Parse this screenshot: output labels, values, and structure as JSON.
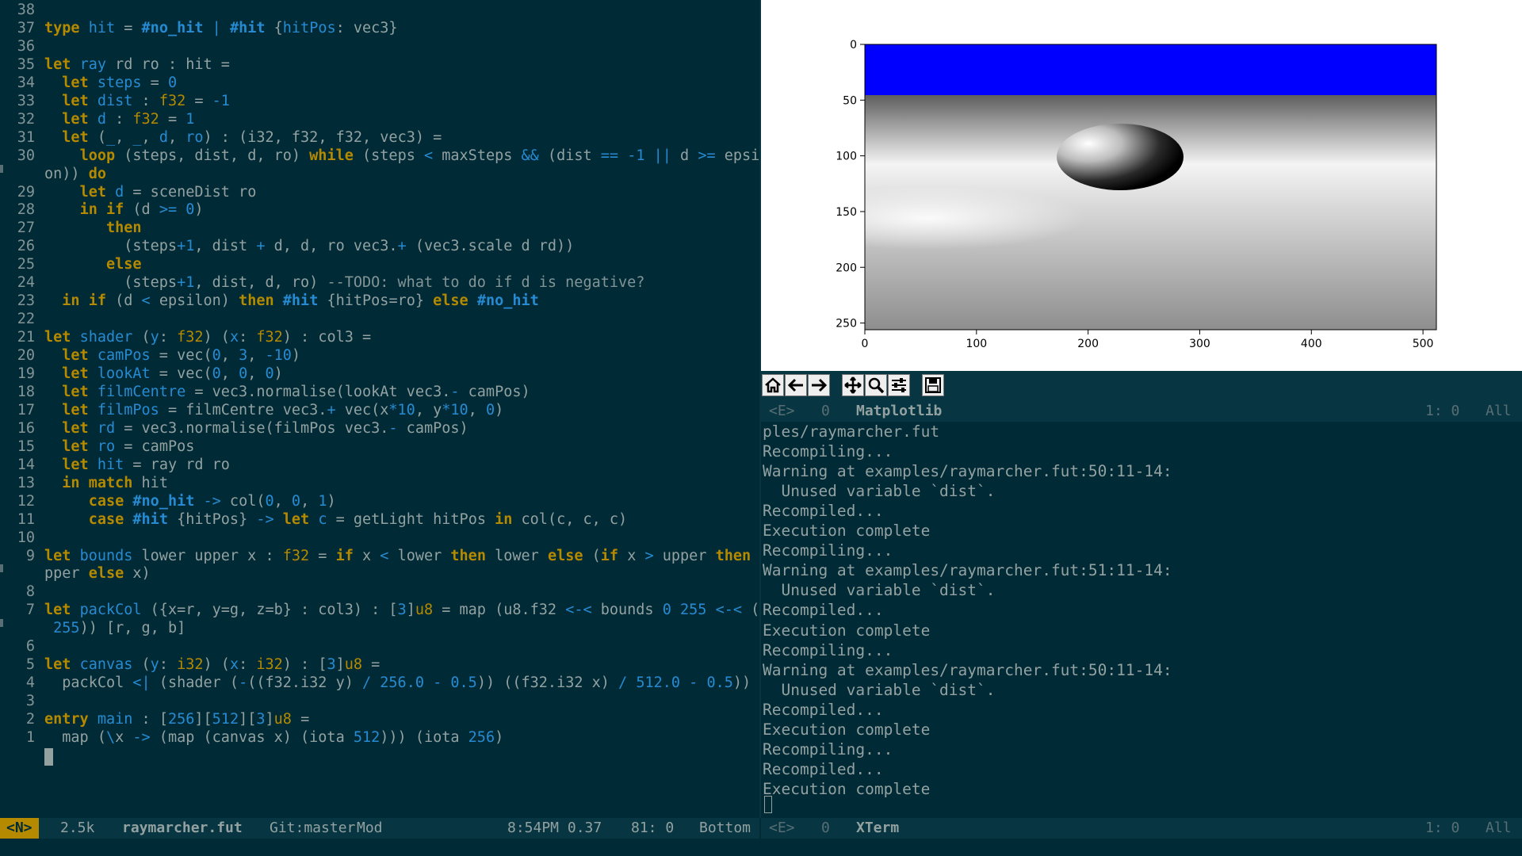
{
  "editor": {
    "lines": [
      {
        "n": "38",
        "c": ""
      },
      {
        "n": "37",
        "c": "<span class=\"k\">type</span> <span class=\"v\">hit</span> = <span class=\"tag\">#no_hit</span> <span class=\"o\">|</span> <span class=\"tag\">#hit</span> {<span class=\"v\">hitPos</span>: vec3}"
      },
      {
        "n": "36",
        "c": ""
      },
      {
        "n": "35",
        "c": "<span class=\"k\">let</span> <span class=\"v\">ray</span> rd ro : hit ="
      },
      {
        "n": "34",
        "c": "  <span class=\"k\">let</span> <span class=\"v\">steps</span> = <span class=\"n\">0</span>"
      },
      {
        "n": "33",
        "c": "  <span class=\"k\">let</span> <span class=\"v\">dist</span> : <span class=\"t\">f32</span> = <span class=\"n\">-1</span>"
      },
      {
        "n": "32",
        "c": "  <span class=\"k\">let</span> <span class=\"v\">d</span> : <span class=\"t\">f32</span> = <span class=\"n\">1</span>"
      },
      {
        "n": "31",
        "c": "  <span class=\"k\">let</span> (<span class=\"v\">_</span>, <span class=\"v\">_</span>, <span class=\"v\">d</span>, <span class=\"v\">ro</span>) : (i32, f32, f32, vec3) ="
      },
      {
        "n": "30",
        "c": "    <span class=\"k\">loop</span> (steps, dist, d, ro) <span class=\"k\">while</span> (steps <span class=\"o\">&lt;</span> maxSteps <span class=\"o\">&amp;&amp;</span> (dist <span class=\"o\">==</span> <span class=\"n\">-1</span> <span class=\"o\">||</span> d <span class=\"o\">&gt;=</span> epsil"
      },
      {
        "n": "",
        "c": "on)) <span class=\"k\">do</span>",
        "cont": true
      },
      {
        "n": "29",
        "c": "    <span class=\"k\">let</span> <span class=\"v\">d</span> = sceneDist ro"
      },
      {
        "n": "28",
        "c": "    <span class=\"k\">in</span> <span class=\"k\">if</span> (d <span class=\"o\">&gt;=</span> <span class=\"n\">0</span>)"
      },
      {
        "n": "27",
        "c": "       <span class=\"k\">then</span>"
      },
      {
        "n": "26",
        "c": "         (steps<span class=\"o\">+</span><span class=\"n\">1</span>, dist <span class=\"o\">+</span> d, d, ro vec3.<span class=\"o\">+</span> (vec3.scale d rd))"
      },
      {
        "n": "25",
        "c": "       <span class=\"k\">else</span>"
      },
      {
        "n": "24",
        "c": "         (steps<span class=\"o\">+</span><span class=\"n\">1</span>, dist, d, ro) <span class=\"c\">--TODO: what to do if d is negative?</span>"
      },
      {
        "n": "23",
        "c": "  <span class=\"k\">in</span> <span class=\"k\">if</span> (d <span class=\"o\">&lt;</span> epsilon) <span class=\"k\">then</span> <span class=\"tag\">#hit</span> {hitPos=ro} <span class=\"k\">else</span> <span class=\"tag\">#no_hit</span>"
      },
      {
        "n": "22",
        "c": ""
      },
      {
        "n": "21",
        "c": "<span class=\"k\">let</span> <span class=\"v\">shader</span> (<span class=\"v\">y</span>: <span class=\"t\">f32</span>) (<span class=\"v\">x</span>: <span class=\"t\">f32</span>) : col3 ="
      },
      {
        "n": "20",
        "c": "  <span class=\"k\">let</span> <span class=\"v\">camPos</span> = vec(<span class=\"n\">0</span>, <span class=\"n\">3</span>, <span class=\"n\">-10</span>)"
      },
      {
        "n": "19",
        "c": "  <span class=\"k\">let</span> <span class=\"v\">lookAt</span> = vec(<span class=\"n\">0</span>, <span class=\"n\">0</span>, <span class=\"n\">0</span>)"
      },
      {
        "n": "18",
        "c": "  <span class=\"k\">let</span> <span class=\"v\">filmCentre</span> = vec3.normalise(lookAt vec3.<span class=\"o\">-</span> camPos)"
      },
      {
        "n": "17",
        "c": "  <span class=\"k\">let</span> <span class=\"v\">filmPos</span> = filmCentre vec3.<span class=\"o\">+</span> vec(x<span class=\"o\">*</span><span class=\"n\">10</span>, y<span class=\"o\">*</span><span class=\"n\">10</span>, <span class=\"n\">0</span>)"
      },
      {
        "n": "16",
        "c": "  <span class=\"k\">let</span> <span class=\"v\">rd</span> = vec3.normalise(filmPos vec3.<span class=\"o\">-</span> camPos)"
      },
      {
        "n": "15",
        "c": "  <span class=\"k\">let</span> <span class=\"v\">ro</span> = camPos"
      },
      {
        "n": "14",
        "c": "  <span class=\"k\">let</span> <span class=\"v\">hit</span> = ray rd ro"
      },
      {
        "n": "13",
        "c": "  <span class=\"k\">in</span> <span class=\"k\">match</span> hit"
      },
      {
        "n": "12",
        "c": "     <span class=\"k\">case</span> <span class=\"tag\">#no_hit</span> <span class=\"o\">-&gt;</span> col(<span class=\"n\">0</span>, <span class=\"n\">0</span>, <span class=\"n\">1</span>)"
      },
      {
        "n": "11",
        "c": "     <span class=\"k\">case</span> <span class=\"tag\">#hit</span> {hitPos} <span class=\"o\">-&gt;</span> <span class=\"k\">let</span> <span class=\"v\">c</span> = getLight hitPos <span class=\"k\">in</span> col(c, c, c)"
      },
      {
        "n": "10",
        "c": ""
      },
      {
        "n": "9",
        "c": "<span class=\"k\">let</span> <span class=\"v\">bounds</span> lower upper x : <span class=\"t\">f32</span> = <span class=\"k\">if</span> x <span class=\"o\">&lt;</span> lower <span class=\"k\">then</span> lower <span class=\"k\">else</span> (<span class=\"k\">if</span> x <span class=\"o\">&gt;</span> upper <span class=\"k\">then</span> u"
      },
      {
        "n": "",
        "c": "pper <span class=\"k\">else</span> x)",
        "cont": true
      },
      {
        "n": "8",
        "c": ""
      },
      {
        "n": "7",
        "c": "<span class=\"k\">let</span> <span class=\"v\">packCol</span> ({x=r, y=g, z=b} : col3) : [<span class=\"n\">3</span>]<span class=\"t\">u8</span> = map (u8.f32 <span class=\"o\">&lt;-&lt;</span> bounds <span class=\"n\">0</span> <span class=\"n\">255</span> <span class=\"o\">&lt;-&lt;</span> (<span class=\"o\">*</span>"
      },
      {
        "n": "",
        "c": " <span class=\"n\">255</span>)) [r, g, b]",
        "cont": true
      },
      {
        "n": "6",
        "c": ""
      },
      {
        "n": "5",
        "c": "<span class=\"k\">let</span> <span class=\"v\">canvas</span> (<span class=\"v\">y</span>: <span class=\"t\">i32</span>) (<span class=\"v\">x</span>: <span class=\"t\">i32</span>) : [<span class=\"n\">3</span>]<span class=\"t\">u8</span> ="
      },
      {
        "n": "4",
        "c": "  packCol <span class=\"o\">&lt;|</span> (shader (<span class=\"o\">-</span>((f32.i32 y) <span class=\"o\">/</span> <span class=\"n\">256.0</span> <span class=\"o\">-</span> <span class=\"n\">0.5</span>)) ((f32.i32 x) <span class=\"o\">/</span> <span class=\"n\">512.0</span> <span class=\"o\">-</span> <span class=\"n\">0.5</span>))"
      },
      {
        "n": "3",
        "c": ""
      },
      {
        "n": "2",
        "c": "<span class=\"k\">entry</span> <span class=\"v\">main</span> : [<span class=\"n\">256</span>][<span class=\"n\">512</span>][<span class=\"n\">3</span>]<span class=\"t\">u8</span> ="
      },
      {
        "n": "1",
        "c": "  map (<span class=\"o\">\\</span>x <span class=\"o\">-&gt;</span> (map (canvas x) (iota <span class=\"n\">512</span>))) (iota <span class=\"n\">256</span>)"
      }
    ]
  },
  "plot": {
    "x_ticks": [
      "0",
      "100",
      "200",
      "300",
      "400",
      "500"
    ],
    "y_ticks": [
      "0",
      "50",
      "100",
      "150",
      "200",
      "250"
    ],
    "colors": {
      "sky": "#0000ff"
    }
  },
  "matplotlib_modeline": {
    "state": "<E>",
    "count": "0",
    "buffer": "Matplotlib",
    "pos": "1: 0",
    "scroll": "All"
  },
  "terminal": {
    "lines": [
      "ples/raymarcher.fut",
      "Recompiling...",
      "Warning at examples/raymarcher.fut:50:11-14:",
      "  Unused variable `dist`.",
      "Recompiled...",
      "Execution complete",
      "Recompiling...",
      "Warning at examples/raymarcher.fut:51:11-14:",
      "  Unused variable `dist`.",
      "Recompiled...",
      "Execution complete",
      "Recompiling...",
      "Warning at examples/raymarcher.fut:50:11-14:",
      "  Unused variable `dist`.",
      "Recompiled...",
      "Execution complete",
      "Recompiling...",
      "Recompiled...",
      "Execution complete"
    ]
  },
  "editor_modeline": {
    "state": "<N>",
    "size": "2.5k",
    "buffer": "raymarcher.fut",
    "vcs": "Git:master",
    "modified": "Mod",
    "time": "8:54PM 0.37",
    "pos": "81: 0",
    "scroll": "Bottom"
  },
  "xterm_modeline": {
    "state": "<E>",
    "count": "0",
    "buffer": "XTerm",
    "pos": "1: 0",
    "scroll": "All"
  },
  "toolbar": {
    "buttons": [
      "home-icon",
      "back-icon",
      "forward-icon",
      "pan-icon",
      "zoom-icon",
      "configure-subplots-icon",
      "save-icon"
    ]
  }
}
